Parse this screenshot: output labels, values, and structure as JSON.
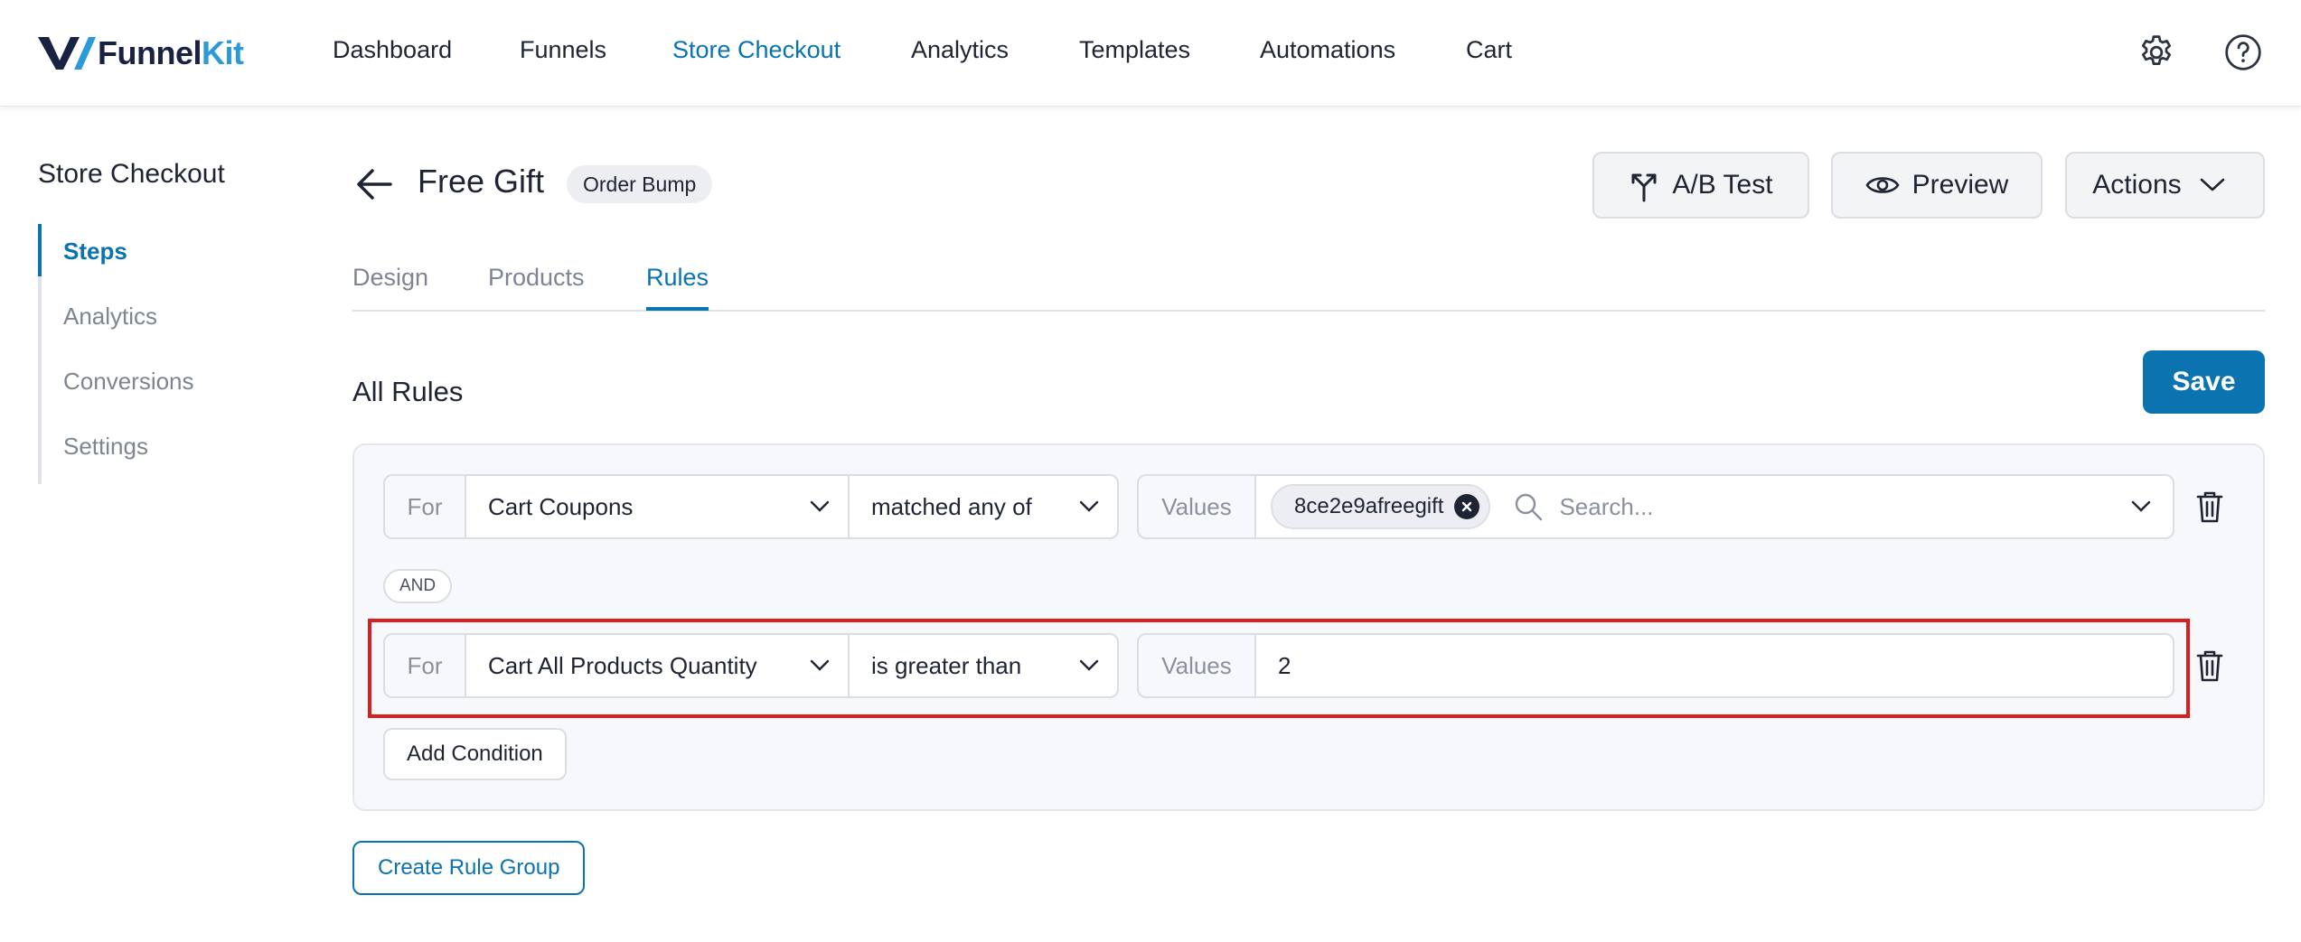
{
  "brand": {
    "part1": "Funnel",
    "part2": "Kit"
  },
  "nav": {
    "items": [
      {
        "label": "Dashboard"
      },
      {
        "label": "Funnels"
      },
      {
        "label": "Store Checkout"
      },
      {
        "label": "Analytics"
      },
      {
        "label": "Templates"
      },
      {
        "label": "Automations"
      },
      {
        "label": "Cart"
      }
    ],
    "active": "Store Checkout"
  },
  "sidebar": {
    "title": "Store Checkout",
    "items": [
      {
        "label": "Steps"
      },
      {
        "label": "Analytics"
      },
      {
        "label": "Conversions"
      },
      {
        "label": "Settings"
      }
    ],
    "active": "Steps"
  },
  "header": {
    "title": "Free Gift",
    "badge": "Order Bump",
    "ab_test_label": "A/B Test",
    "preview_label": "Preview",
    "actions_label": "Actions"
  },
  "tabs": [
    {
      "label": "Design"
    },
    {
      "label": "Products"
    },
    {
      "label": "Rules"
    }
  ],
  "active_tab": "Rules",
  "rules": {
    "section_title": "All Rules",
    "save_label": "Save",
    "conditions": [
      {
        "for_label": "For",
        "field": "Cart Coupons",
        "operator": "matched any of",
        "values_label": "Values",
        "chips": [
          "8ce2e9afreegift"
        ],
        "search_placeholder": "Search..."
      },
      {
        "for_label": "For",
        "field": "Cart All Products Quantity",
        "operator": "is greater than",
        "values_label": "Values",
        "value": "2",
        "highlighted": true
      }
    ],
    "connector": "AND",
    "add_condition_label": "Add Condition",
    "create_group_label": "Create Rule Group"
  },
  "colors": {
    "accent": "#0a73b0",
    "highlight": "#d81e1e",
    "brand_dark": "#1a2244",
    "brand_light": "#2a9bd8"
  }
}
